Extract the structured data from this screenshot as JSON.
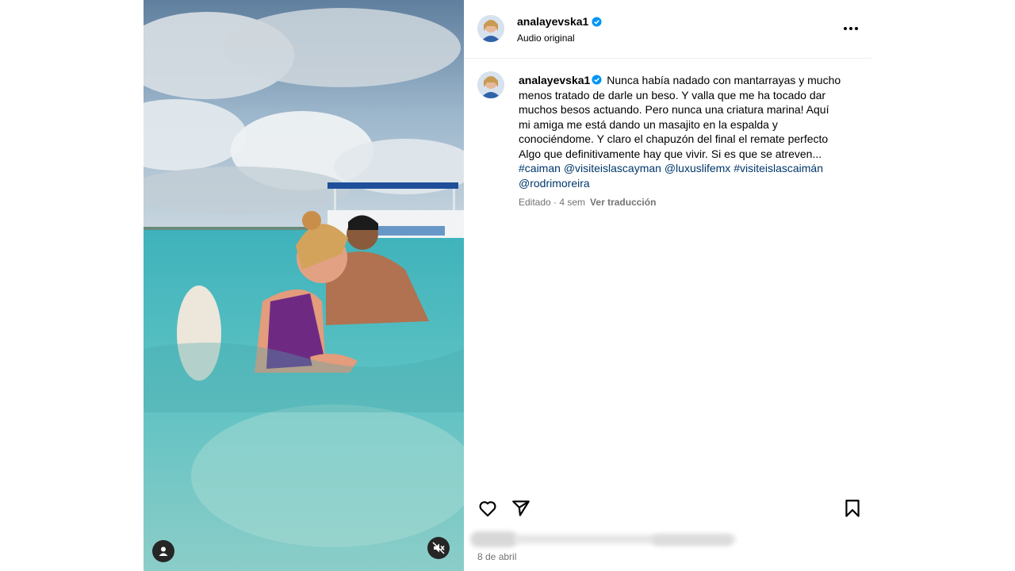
{
  "post": {
    "username": "analayevska1",
    "audio": "Audio original",
    "caption": {
      "username": "analayevska1",
      "text": "Nunca había nadado con mantarrayas y mucho menos tratado de darle un beso. Y valla que me ha tocado dar muchos besos actuando. Pero nunca una criatura marina! Aquí mi amiga me está dando un masajito en la espalda y conociéndome. Y claro el chapuzón del final el remate perfecto Algo que definitivamente hay que vivir. Si es que se atreven...",
      "tags": [
        "#caiman",
        "@visiteislascayman",
        "@luxuslifemx",
        "#visiteislascaimán",
        "@rodrimoreira"
      ]
    },
    "meta": {
      "edited": "Editado · 4 sem",
      "translate": "Ver traducción"
    },
    "date": "8 de abril"
  },
  "icons": {
    "verified": "verified-badge-icon",
    "more": "more-options-icon",
    "like": "heart-icon",
    "share": "send-icon",
    "save": "bookmark-icon",
    "tag": "user-tag-icon",
    "mute": "speaker-muted-icon"
  },
  "colors": {
    "verified": "#0095f6",
    "link": "#00376b",
    "muted_text": "#737373"
  }
}
